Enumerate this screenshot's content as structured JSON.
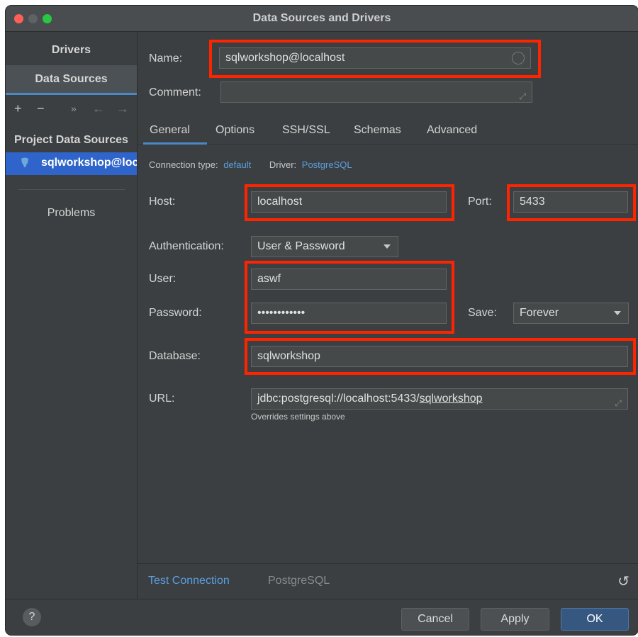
{
  "window": {
    "title": "Data Sources and Drivers",
    "traffic_colors": [
      "#ff5f57",
      "#5f6264",
      "#28c840"
    ]
  },
  "sidebar": {
    "tabs": [
      {
        "label": "Drivers"
      },
      {
        "label": "Data Sources"
      }
    ],
    "tools": {
      "add": "+",
      "remove": "−",
      "more": "»",
      "back": "←",
      "forward": "→"
    },
    "section_title": "Project Data Sources",
    "item_label": "sqlworkshop@localhost",
    "problems_label": "Problems"
  },
  "form": {
    "name_label": "Name:",
    "name_value": "sqlworkshop@localhost",
    "comment_label": "Comment:",
    "comment_value": "",
    "tabs": [
      "General",
      "Options",
      "SSH/SSL",
      "Schemas",
      "Advanced"
    ],
    "connection_type_label": "Connection type:",
    "connection_type_value": "default",
    "driver_label": "Driver:",
    "driver_value": "PostgreSQL",
    "host_label": "Host:",
    "host_value": "localhost",
    "port_label": "Port:",
    "port_value": "5433",
    "auth_label": "Authentication:",
    "auth_value": "User & Password",
    "user_label": "User:",
    "user_value": "aswf",
    "password_label": "Password:",
    "password_value": "••••••••••••",
    "save_label": "Save:",
    "save_value": "Forever",
    "database_label": "Database:",
    "database_value": "sqlworkshop",
    "url_label": "URL:",
    "url_prefix": "jdbc:postgresql://localhost:5433/",
    "url_db": "sqlworkshop",
    "url_hint": "Overrides settings above"
  },
  "bottom": {
    "test_connection": "Test Connection",
    "driver_name": "PostgreSQL",
    "revert_icon": "↺"
  },
  "footer": {
    "help": "?",
    "cancel": "Cancel",
    "apply": "Apply",
    "ok": "OK"
  },
  "colors": {
    "highlight": "#ff2400",
    "accent": "#4a88c7",
    "selection": "#2f65ca",
    "link": "#5a9fe0"
  }
}
